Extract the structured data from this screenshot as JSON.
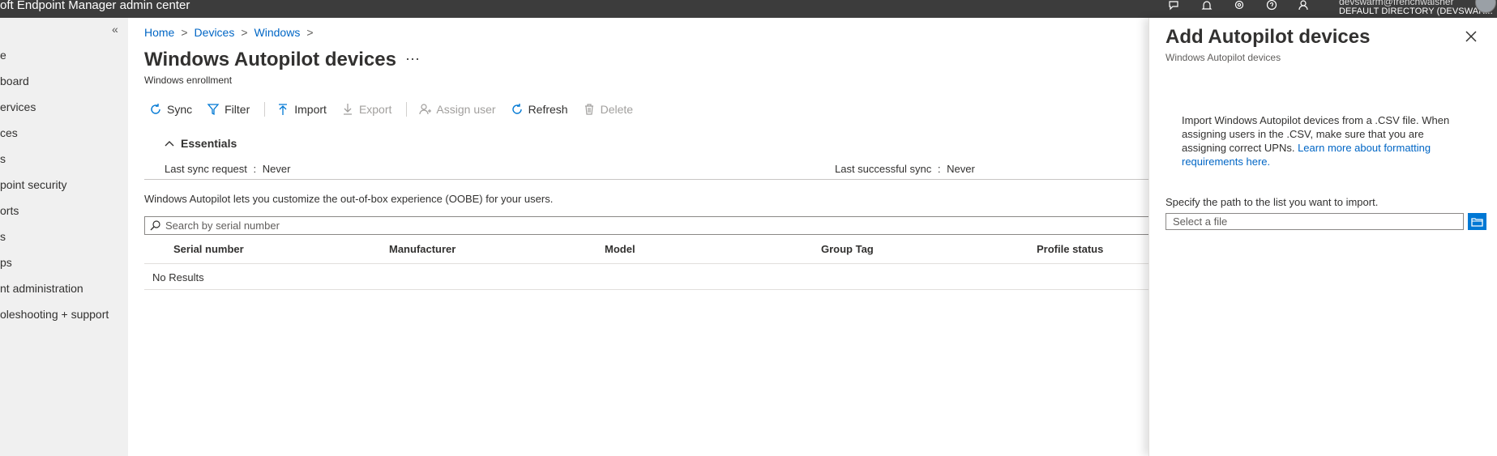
{
  "app": {
    "title": "oft Endpoint Manager admin center"
  },
  "user": {
    "email": "devswarm@frenchwalsher",
    "directory": "DEFAULT DIRECTORY (DEVSWAR..."
  },
  "sidebar": {
    "items": [
      {
        "label": "e"
      },
      {
        "label": "board"
      },
      {
        "label": "ervices"
      },
      {
        "label": "ces"
      },
      {
        "label": "s"
      },
      {
        "label": "point security"
      },
      {
        "label": "orts"
      },
      {
        "label": "s"
      },
      {
        "label": "ps"
      },
      {
        "label": "nt administration"
      },
      {
        "label": "oleshooting + support"
      }
    ]
  },
  "breadcrumb": {
    "home": "Home",
    "devices": "Devices",
    "windows": "Windows",
    "sep": ">"
  },
  "page": {
    "title": "Windows Autopilot devices",
    "subtitle": "Windows enrollment",
    "more": "···"
  },
  "toolbar": {
    "sync": "Sync",
    "filter": "Filter",
    "import": "Import",
    "export": "Export",
    "assign_user": "Assign user",
    "refresh": "Refresh",
    "delete": "Delete"
  },
  "essentials": {
    "label": "Essentials",
    "last_sync_label": "Last sync request",
    "last_sync_value": "Never",
    "last_success_label": "Last successful sync",
    "last_success_value": "Never",
    "colon": ":"
  },
  "info": "Windows Autopilot lets you customize the out-of-box experience (OOBE) for your users.",
  "search": {
    "placeholder": "Search by serial number"
  },
  "table": {
    "columns": [
      "Serial number",
      "Manufacturer",
      "Model",
      "Group Tag",
      "Profile status"
    ],
    "empty": "No Results"
  },
  "panel": {
    "title": "Add Autopilot devices",
    "subtitle": "Windows Autopilot devices",
    "description": "Import Windows Autopilot devices from a .CSV file. When assigning users in the .CSV, make sure that you are assigning correct UPNs.",
    "link": "Learn more about formatting requirements here.",
    "file_label": "Specify the path to the list you want to import.",
    "file_placeholder": "Select a file"
  },
  "colors": {
    "accent": "#0078d4",
    "link": "#0066c5",
    "topbar": "#3c3c3c",
    "nav_bg": "#f0f0f0"
  }
}
